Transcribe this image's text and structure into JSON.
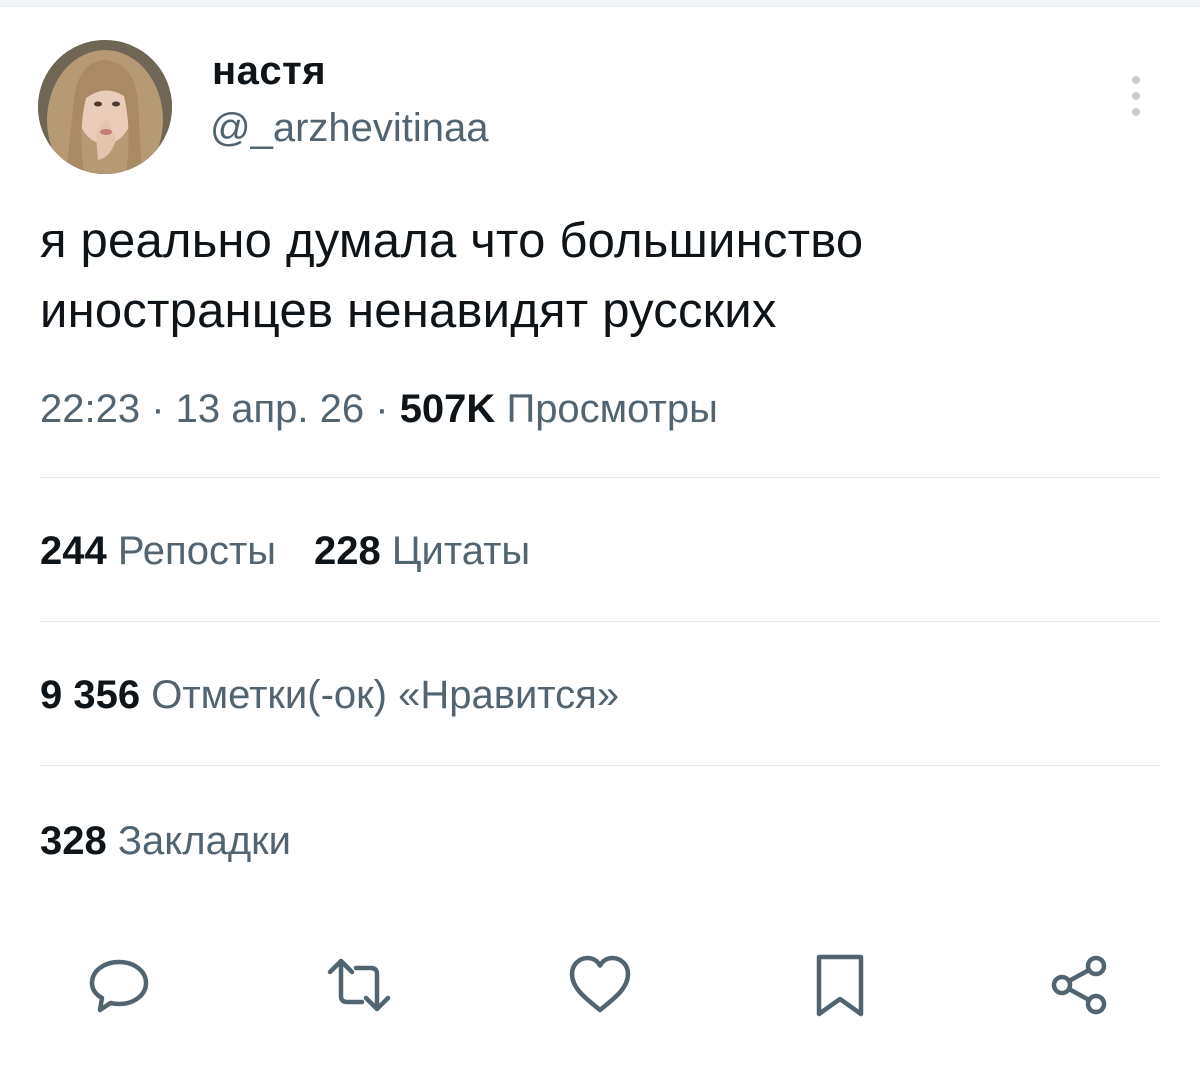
{
  "user": {
    "display_name": "настя",
    "handle": "@_arzhevitinaa"
  },
  "tweet": {
    "text": "я реально думала что большинство иностранцев ненавидят русских",
    "time": "22:23",
    "date": "13 апр. 26",
    "views_count": "507K",
    "views_label": "Просмотры"
  },
  "stats": {
    "reposts_count": "244",
    "reposts_label": "Репосты",
    "quotes_count": "228",
    "quotes_label": "Цитаты",
    "likes_count": "9 356",
    "likes_label": "Отметки(-ок) «Нравится»",
    "bookmarks_count": "328",
    "bookmarks_label": "Закладки"
  },
  "icons": {
    "reply": "reply-icon",
    "repost": "repost-icon",
    "like": "heart-icon",
    "bookmark": "bookmark-icon",
    "share": "share-icon",
    "more": "more-vertical-icon"
  },
  "colors": {
    "text": "#0f1419",
    "secondary": "#536471",
    "divider": "#e1e6ea",
    "icon": "#536471"
  }
}
